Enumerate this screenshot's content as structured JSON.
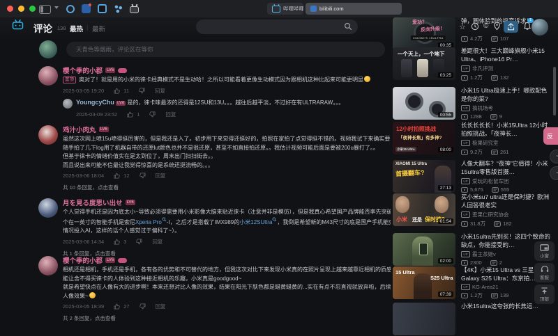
{
  "browser": {
    "tab1": "哔哩哔哩 (゜-゜)…",
    "tab2": "bilibili.com",
    "notification_count": "1"
  },
  "header": {
    "comments_title": "评论",
    "comments_count": "138",
    "tab_hot": "最热",
    "tab_divider": "|",
    "tab_new": "最新"
  },
  "comment_input": {
    "placeholder": "天青色等烟雨，评论区在等你"
  },
  "ui": {
    "reply": "回复",
    "lv_badge": "LV6"
  },
  "comments": [
    {
      "name": "樱个季的小郡",
      "pinned": "置顶",
      "lines": [
        "奥对了！就是用的小米的徕卡经典模式不是生动哈！之所以可能看着更像生动模式因为跟相机这种比起来可能更明显"
      ],
      "date": "2025-03-05 19:20",
      "likes": "11",
      "reply": {
        "name": "YoungcyChu",
        "text": "是的，徕卡味最浓的还得是12SU和13U。。。越往后越平淡，不过好在有ULTRARAW。。。",
        "date": "2025-03-09 23:52",
        "likes": "1"
      }
    },
    {
      "name": "鸡汁小肉丸",
      "lines": [
        "虽然这次网上喷15u喷得挺厉害的，但是我还是入了。初步用下来觉得还挺好的，拍照在家拍了点觉得挺不错的。视频我试下来确实要差一些，晚上家里",
        "随手拍了几下log用了机器自带的还原lut颜色也并不是很还原，甚至不如直接拍还原。。我估计视频可能后面是要被200u暴打了。。",
        "但基于徕卡的情绪价值实在是太到位了，周末出门扫扫街去。。",
        "而且说出来可能不信最让我觉得惊喜的是系统还挺流畅的。。。"
      ],
      "date": "2025-03-06 18:04",
      "likes": "12",
      "more": "共 10 条回复，点击查看"
    },
    {
      "name": "月を見る度思い出せ",
      "line1": "个人觉得手机还是因为底太小~导致必须得需要用小米影像大脑来贴近徕卡（注意并非是模仿），但是我真心希望国产品牌能否率先突破更大底（注意：第一",
      "line2a": "个在一英寸的智能手机是索尼",
      "link1": "Xperia Pro",
      "line2b": "-I，之后才是搭载了IMX989的",
      "link2": "小米12SUltra",
      "line2c": "，我倒是希望新的M43尺寸的底是国产手机能突破，不能将手机",
      "line3": "情况投入AI，这样的话个人感觉过于偏科了~）。",
      "date": "2025-03-06 14:34",
      "likes": "3",
      "more": "共 1 条回复，点击查看"
    },
    {
      "name": "樱个季的小郡",
      "lines": [
        "相机还是相机，手机还是手机，各有各的优势和不可替代的地方，但我这次对比下来发现小米真的在照片呈现上越来越靠近相机的质感和徕卡的色彩，几",
        "能让舍不得买徕卡的人体验到这种接近相机的乐趣，小米真是goodgood~",
        "就是希望快点在人像有大的进步啊！本来还想对比人像的效果，结果在阳光下肤色都是蜡黄蜡黄的...实在有点不忍直视就放弃啦，后续更新稳定后再对比",
        "人像效果~"
      ],
      "date": "2025-03-05 18:39",
      "likes": "27",
      "more": "共 2 条回复，点击查看"
    }
  ],
  "sidebar": {
    "videos": [
      {
        "title": "弹，圆体验到的福音诉求！",
        "uploader": "",
        "views": "4.2万",
        "danmaku": "107",
        "duration": "00:35",
        "overlay": {
          "a": "爱功？",
          "b": "反向升级！",
          "badge": "XIAOMI'S 15ULTRA"
        }
      },
      {
        "title": "差距很大！三大巅峰旗舰小米15 Ultra、iPhone16 Pr…",
        "uploader": "非凡评测",
        "views": "1.2万",
        "danmaku": "132",
        "duration": "03:25",
        "overlay": {
          "a": "一个天上，一个地下"
        }
      },
      {
        "title": "小米15 Ultra极速上手！哪款配色是你的菜?",
        "uploader": "搞机场考",
        "views": "1288",
        "danmaku": "9",
        "duration": "00:55",
        "overlay": {}
      },
      {
        "title": "长长长长长！小米15Ultra 12小时拍照挑战。「夜神长…",
        "uploader": "极果研究室",
        "views": "9.2万",
        "danmaku": "261",
        "duration": "08:00",
        "overlay": {
          "a": "12小时拍照挑战",
          "b": "「夜神长焦」有多神?",
          "c": "小米15 Ultra"
        }
      },
      {
        "title": "人像大翻车？“夜神”它值得！小米15ultra零售版首摄…",
        "uploader": "爱玩的松鼠军团",
        "views": "5,675",
        "danmaku": "555",
        "duration": "27:13",
        "overlay": {
          "a": "XIAOMI 15 Ultra",
          "b": "首摄翻车?"
        }
      },
      {
        "title": "买小米su7 ultra还是保时捷？欧洲人回答很老实",
        "uploader": "歪果仁研究协会",
        "views": "31.8万",
        "danmaku": "182",
        "duration": "01:54",
        "overlay": {
          "a": "小米",
          "b": "还是",
          "c": "保时捷?"
        }
      },
      {
        "title": "小米15ultra先别买！这四个致命的缺点，你能接受的…",
        "uploader": "霸王茶姬v",
        "views": "2300",
        "danmaku": "2",
        "duration": "02:00",
        "overlay": {}
      },
      {
        "title": "【4K】小米15 Ultra vs 三星Galaxy S25 Ultra：东京拍…",
        "uploader": "KG-Area21",
        "views": "1.2万",
        "danmaku": "139",
        "duration": "07:39",
        "overlay": {
          "a": "15 Ultra",
          "b": "S25 Ultra"
        }
      },
      {
        "title": "小米15ultra这夸张的长焦远…",
        "uploader": "",
        "views": "",
        "danmaku": "",
        "duration": "",
        "overlay": {}
      }
    ]
  },
  "floating": {
    "mini_window": "小窗",
    "service": "客服",
    "back_top": "顶部",
    "feedback": "反"
  }
}
